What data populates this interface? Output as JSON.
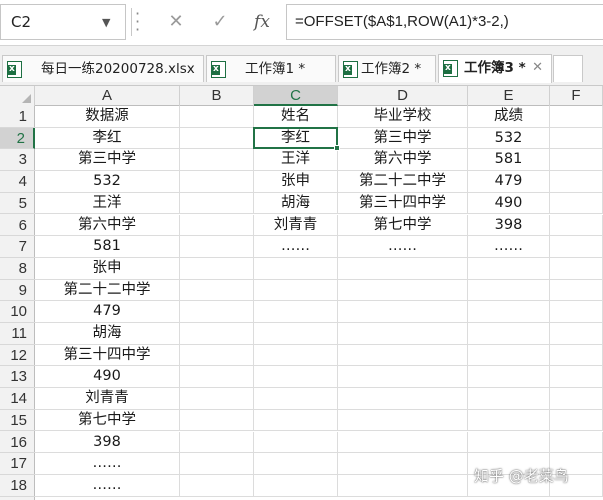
{
  "formula_bar": {
    "name_box": "C2",
    "cancel_icon": "✕",
    "enter_icon": "✓",
    "fx_label": "fx",
    "formula": "=OFFSET($A$1,ROW(A1)*3-2,)"
  },
  "tabs": [
    {
      "label": "每日一练20200728.xlsx",
      "active": false
    },
    {
      "label": "工作簿1 *",
      "active": false
    },
    {
      "label": "工作簿2 *",
      "active": false
    },
    {
      "label": "工作簿3 *",
      "active": true,
      "close": "✕"
    }
  ],
  "columns": [
    "A",
    "B",
    "C",
    "D",
    "E",
    "F"
  ],
  "selected_column": "C",
  "rows": [
    "1",
    "2",
    "3",
    "4",
    "5",
    "6",
    "7",
    "8",
    "9",
    "10",
    "11",
    "12",
    "13",
    "14",
    "15",
    "16",
    "17",
    "18"
  ],
  "selected_row": "2",
  "sheet": {
    "A": [
      "数据源",
      "李红",
      "第三中学",
      "532",
      "王洋",
      "第六中学",
      "581",
      "张申",
      "第二十二中学",
      "479",
      "胡海",
      "第三十四中学",
      "490",
      "刘青青",
      "第七中学",
      "398",
      "……",
      "……"
    ],
    "C": [
      "姓名",
      "李红",
      "王洋",
      "张申",
      "胡海",
      "刘青青",
      "……"
    ],
    "D": [
      "毕业学校",
      "第三中学",
      "第六中学",
      "第二十二中学",
      "第三十四中学",
      "第七中学",
      "……"
    ],
    "E": [
      "成绩",
      "532",
      "581",
      "479",
      "490",
      "398",
      "……"
    ]
  },
  "active_cell": "C2",
  "watermark": "知乎 @老菜鸟",
  "colors": {
    "accent": "#217346"
  }
}
